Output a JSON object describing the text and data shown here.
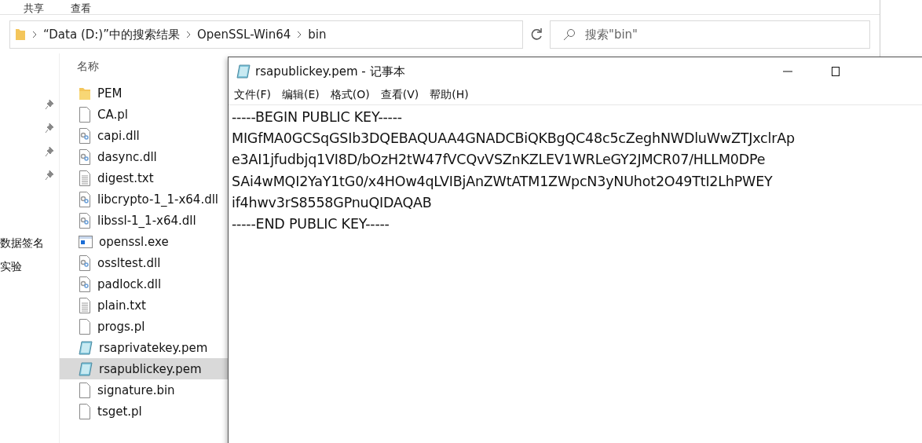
{
  "explorer": {
    "ribbon_tabs": [
      "共享",
      "查看"
    ],
    "breadcrumb": [
      "“Data (D:)”中的搜索结果",
      "OpenSSL-Win64",
      "bin"
    ],
    "search": {
      "placeholder": "搜索\"bin\""
    },
    "sidebar": {
      "items": [
        {
          "label": "数据签名"
        },
        {
          "label": "实验"
        }
      ]
    },
    "column_header": "名称",
    "files": [
      {
        "name": "PEM",
        "kind": "folder",
        "selected": false
      },
      {
        "name": "CA.pl",
        "kind": "file",
        "selected": false
      },
      {
        "name": "capi.dll",
        "kind": "dll",
        "selected": false
      },
      {
        "name": "dasync.dll",
        "kind": "dll",
        "selected": false
      },
      {
        "name": "digest.txt",
        "kind": "text",
        "selected": false
      },
      {
        "name": "libcrypto-1_1-x64.dll",
        "kind": "dll",
        "selected": false
      },
      {
        "name": "libssl-1_1-x64.dll",
        "kind": "dll",
        "selected": false
      },
      {
        "name": "openssl.exe",
        "kind": "exe",
        "selected": false
      },
      {
        "name": "ossltest.dll",
        "kind": "dll",
        "selected": false
      },
      {
        "name": "padlock.dll",
        "kind": "dll",
        "selected": false
      },
      {
        "name": "plain.txt",
        "kind": "text",
        "selected": false
      },
      {
        "name": "progs.pl",
        "kind": "file",
        "selected": false
      },
      {
        "name": "rsaprivatekey.pem",
        "kind": "pem",
        "selected": false
      },
      {
        "name": "rsapublickey.pem",
        "kind": "pem",
        "selected": true
      },
      {
        "name": "signature.bin",
        "kind": "file",
        "selected": false
      },
      {
        "name": "tsget.pl",
        "kind": "file",
        "selected": false
      }
    ]
  },
  "notepad": {
    "title": "rsapublickey.pem - 记事本",
    "menu": [
      "文件(F)",
      "编辑(E)",
      "格式(O)",
      "查看(V)",
      "帮助(H)"
    ],
    "lines": [
      "-----BEGIN PUBLIC KEY-----",
      "MIGfMA0GCSqGSIb3DQEBAQUAA4GNADCBiQKBgQC48c5cZeghNWDluWwZTJxclrAp",
      "e3AI1jfudbjq1VI8D/bOzH2tW47fVCQvVSZnKZLEV1WRLeGY2JMCR07/HLLM0DPe",
      "SAi4wMQI2YaY1tG0/x4HOw4qLVIBjAnZWtATM1ZWpcN3yNUhot2O49TtI2LhPWEY",
      "if4hwv3rS8558GPnuQIDAQAB",
      "-----END PUBLIC KEY-----"
    ]
  }
}
